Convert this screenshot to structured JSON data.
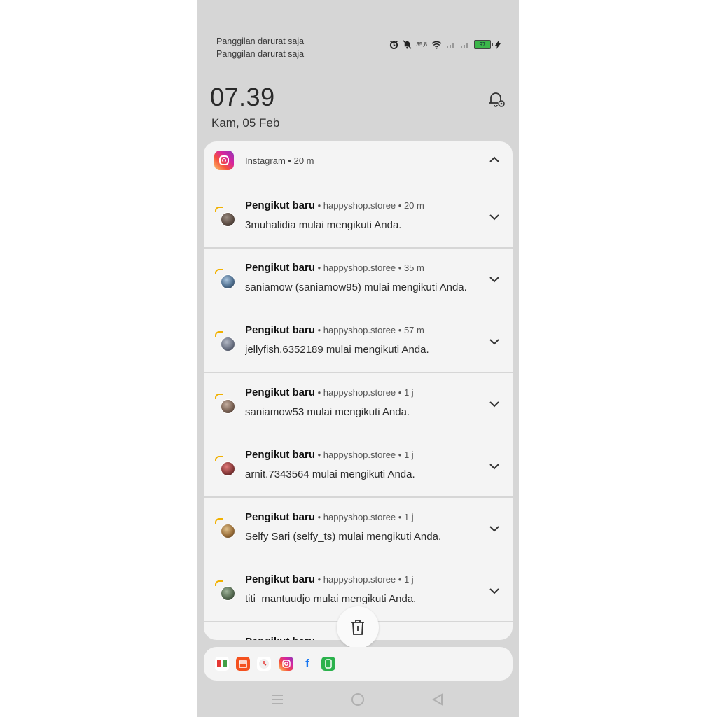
{
  "status_bar": {
    "carrier_line1": "Panggilan darurat saja",
    "carrier_line2": "Panggilan darurat saja",
    "network_speed": "35,8",
    "battery": "97"
  },
  "lock": {
    "time": "07.39",
    "date": "Kam, 05 Feb"
  },
  "notification_group": {
    "app_name": "Instagram",
    "age": "20 m",
    "items": [
      {
        "title": "Pengikut baru",
        "account": "happyshop.storee",
        "age": "20 m",
        "body": "3muhalidia mulai mengikuti Anda."
      },
      {
        "title": "Pengikut baru",
        "account": "happyshop.storee",
        "age": "35 m",
        "body": "saniamow (saniamow95) mulai mengikuti Anda."
      },
      {
        "title": "Pengikut baru",
        "account": "happyshop.storee",
        "age": "57 m",
        "body": "jellyfish.6352189 mulai mengikuti Anda."
      },
      {
        "title": "Pengikut baru",
        "account": "happyshop.storee",
        "age": "1 j",
        "body": "saniamow53 mulai mengikuti Anda."
      },
      {
        "title": "Pengikut baru",
        "account": "happyshop.storee",
        "age": "1 j",
        "body": "arnit.7343564 mulai mengikuti Anda."
      },
      {
        "title": "Pengikut baru",
        "account": "happyshop.storee",
        "age": "1 j",
        "body": "Selfy Sari (selfy_ts) mulai mengikuti Anda."
      },
      {
        "title": "Pengikut baru",
        "account": "happyshop.storee",
        "age": "1 j",
        "body": "titi_mantuudjo mulai mengikuti Anda."
      }
    ]
  },
  "dock_icons": [
    "mi-video-icon",
    "calendar-icon",
    "clock-icon",
    "instagram-icon",
    "facebook-icon",
    "messaging-icon"
  ],
  "colors": {
    "shade_background": "#d6d6d6",
    "card_background": "#f4f4f4",
    "battery_green": "#3cb64a"
  }
}
